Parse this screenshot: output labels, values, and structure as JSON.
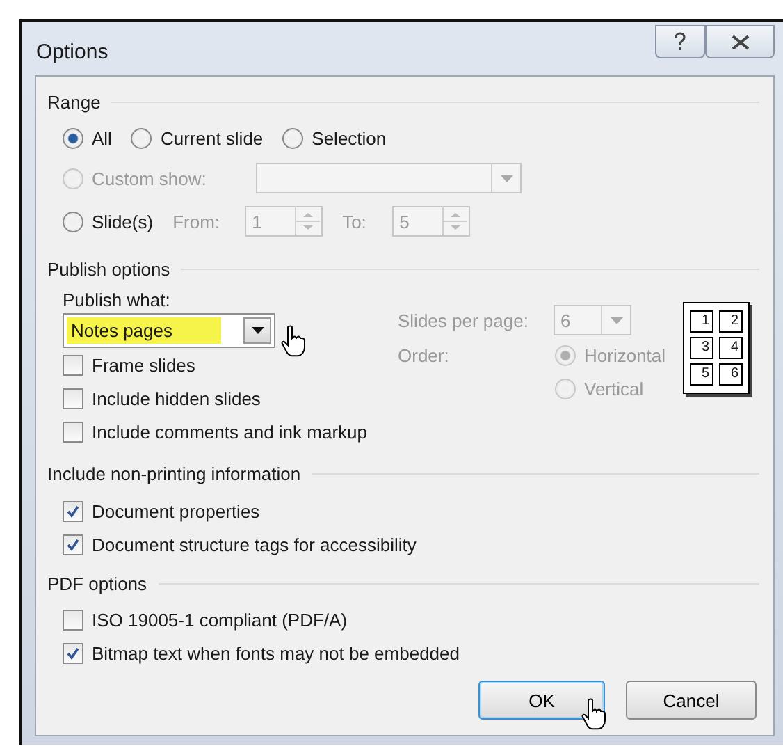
{
  "window": {
    "title": "Options"
  },
  "range": {
    "title": "Range",
    "scopes": [
      {
        "label": "All",
        "selected": true
      },
      {
        "label": "Current slide",
        "selected": false
      },
      {
        "label": "Selection",
        "selected": false
      }
    ],
    "custom_show": {
      "label": "Custom show:",
      "selected": false,
      "disabled": true
    },
    "slides": {
      "label": "Slide(s)",
      "selected": false,
      "from_label": "From:",
      "from": "1",
      "to_label": "To:",
      "to": "5",
      "disabled": true
    }
  },
  "publish": {
    "title": "Publish options",
    "what_label": "Publish what:",
    "what_value": "Notes pages",
    "highlighted": true,
    "checkboxes": [
      {
        "label": "Frame slides",
        "checked": false
      },
      {
        "label": "Include hidden slides",
        "checked": false
      },
      {
        "label": "Include comments and ink markup",
        "checked": false
      }
    ],
    "slides_per_page_label": "Slides per page:",
    "slides_per_page": "6",
    "order_label": "Order:",
    "orders": [
      {
        "label": "Horizontal",
        "selected": true
      },
      {
        "label": "Vertical",
        "selected": false
      }
    ],
    "layout_numbers": [
      "1",
      "2",
      "3",
      "4",
      "5",
      "6"
    ]
  },
  "non_printing": {
    "title": "Include non-printing information",
    "checkboxes": [
      {
        "label": "Document properties",
        "checked": true
      },
      {
        "label": "Document structure tags for accessibility",
        "checked": true
      }
    ]
  },
  "pdf": {
    "title": "PDF options",
    "checkboxes": [
      {
        "label": "ISO 19005-1 compliant (PDF/A)",
        "checked": false
      },
      {
        "label": "Bitmap text when fonts may not be embedded",
        "checked": true
      }
    ]
  },
  "buttons": [
    {
      "label": "OK",
      "default": true
    },
    {
      "label": "Cancel",
      "default": false
    }
  ]
}
